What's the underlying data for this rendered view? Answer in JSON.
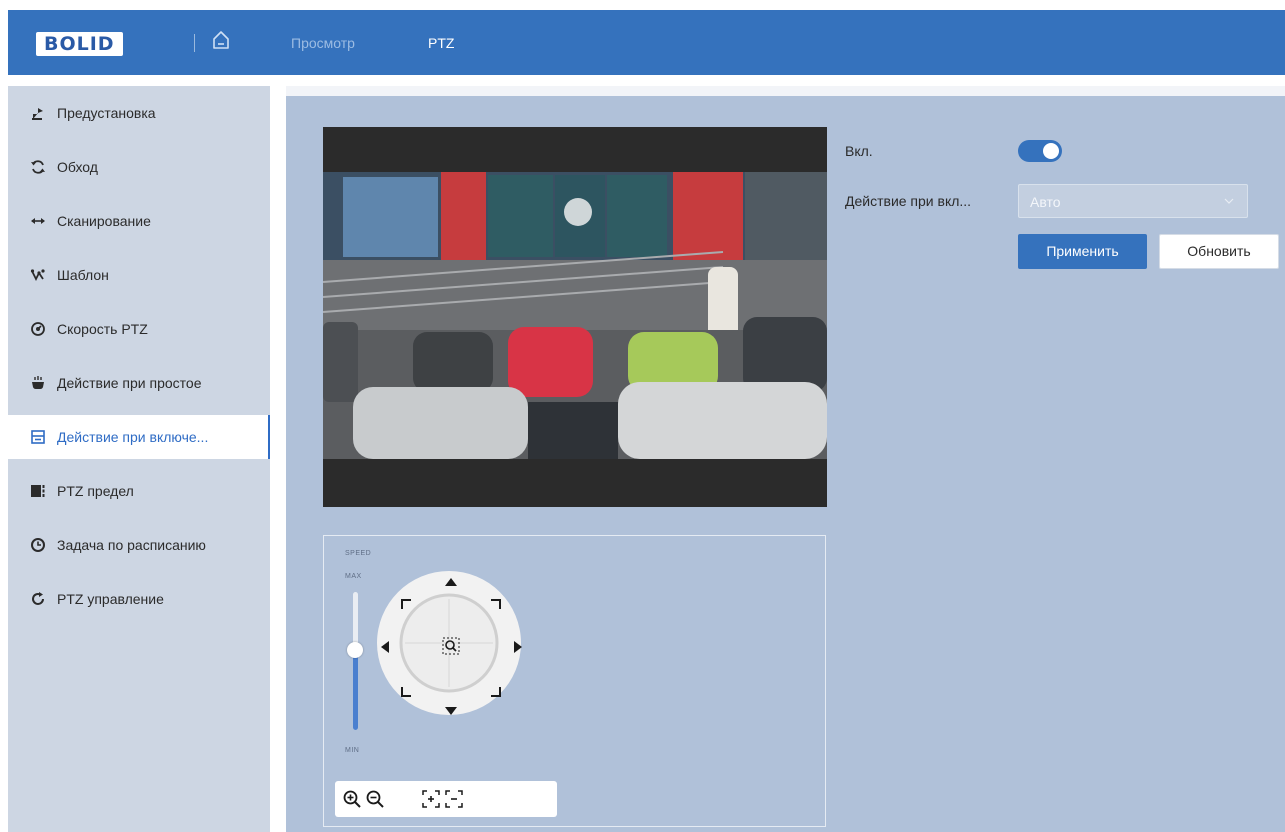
{
  "header": {
    "logo_text": "BOLID",
    "tabs": [
      {
        "label": "Просмотр",
        "active": false
      },
      {
        "label": "PTZ",
        "active": true
      }
    ],
    "brand_color": "#3572bd"
  },
  "sidebar": {
    "items": [
      {
        "label": "Предустановка",
        "icon": "preset-icon",
        "active": false
      },
      {
        "label": "Обход",
        "icon": "tour-icon",
        "active": false
      },
      {
        "label": "Сканирование",
        "icon": "scan-icon",
        "active": false
      },
      {
        "label": "Шаблон",
        "icon": "pattern-icon",
        "active": false
      },
      {
        "label": "Скорость PTZ",
        "icon": "speed-icon",
        "active": false
      },
      {
        "label": "Действие при простое",
        "icon": "idle-icon",
        "active": false
      },
      {
        "label": "Действие при включе...",
        "icon": "power-up-icon",
        "active": true
      },
      {
        "label": "PTZ предел",
        "icon": "limit-icon",
        "active": false
      },
      {
        "label": "Задача по расписанию",
        "icon": "clock-icon",
        "active": false
      },
      {
        "label": "PTZ управление",
        "icon": "refresh-icon",
        "active": false
      }
    ]
  },
  "ptz_control": {
    "speed_label": "SPEED",
    "max_label": "MAX",
    "min_label": "MIN",
    "speed_level": 0.6
  },
  "form": {
    "enable_label": "Вкл.",
    "enable_on": true,
    "action_label": "Действие при вкл...",
    "action_value": "Авто",
    "apply_label": "Применить",
    "refresh_label": "Обновить"
  }
}
